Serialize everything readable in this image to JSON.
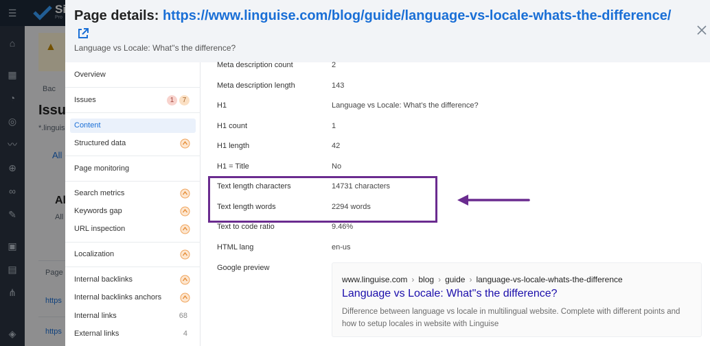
{
  "app": {
    "logo_text": "Si",
    "logo_sub": "Pro",
    "bg_back": "Bac",
    "bg_title": "Issue",
    "bg_sub1": "*.linguis",
    "bg_tab": "All",
    "bg_heading": "Al",
    "bg_heading_sub": "All",
    "bg_col": "Page",
    "bg_link1": "https",
    "bg_link2": "https"
  },
  "modal": {
    "title_prefix": "Page details: ",
    "title_url": "https://www.linguise.com/blog/guide/language-vs-locale-whats-the-difference/",
    "subtitle": "Language vs Locale: What''s the difference?"
  },
  "nav": {
    "overview": "Overview",
    "issues": "Issues",
    "issues_badge_1": "1",
    "issues_badge_2": "7",
    "content": "Content",
    "structured_data": "Structured data",
    "page_monitoring": "Page monitoring",
    "search_metrics": "Search metrics",
    "keywords_gap": "Keywords gap",
    "url_inspection": "URL inspection",
    "localization": "Localization",
    "internal_backlinks": "Internal backlinks",
    "internal_backlinks_anchors": "Internal backlinks anchors",
    "internal_links": "Internal links",
    "internal_links_count": "68",
    "external_links": "External links",
    "external_links_count": "4"
  },
  "rows": [
    {
      "label": "Meta description count",
      "value": "2"
    },
    {
      "label": "Meta description length",
      "value": "143"
    },
    {
      "label": "H1",
      "value": "Language vs Locale: What’s the difference?"
    },
    {
      "label": "H1 count",
      "value": "1"
    },
    {
      "label": "H1 length",
      "value": "42"
    },
    {
      "label": "H1 = Title",
      "value": "No"
    },
    {
      "label": "Text length characters",
      "value": "14731 characters"
    },
    {
      "label": "Text length words",
      "value": "2294 words"
    },
    {
      "label": "Text to code ratio",
      "value": "9.46%"
    },
    {
      "label": "HTML lang",
      "value": "en-us"
    },
    {
      "label": "Google preview",
      "value": ""
    }
  ],
  "google_preview": {
    "crumb_domain": "www.linguise.com",
    "crumb_1": "blog",
    "crumb_2": "guide",
    "crumb_3": "language-vs-locale-whats-the-difference",
    "title": "Language vs Locale: What''s the difference?",
    "description": "Difference between language vs locale in multilingual website. Complete with different points and how to setup locales in website with Linguise"
  },
  "colors": {
    "accent": "#1a6fd6",
    "annotation": "#6a2b8f",
    "badge_red": "#f8d3cd",
    "badge_orange": "#fbe0c4"
  }
}
